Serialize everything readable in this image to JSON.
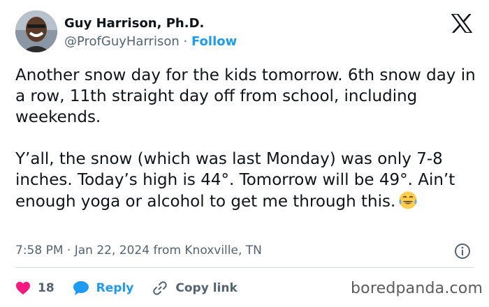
{
  "author": {
    "name": "Guy Harrison, Ph.D.",
    "handle": "@ProfGuyHarrison",
    "separator": "·",
    "follow_label": "Follow"
  },
  "tweet": {
    "paragraph1": "Another snow day for the kids tomorrow. 6th snow day in a row, 11th straight day off from school, including weekends.",
    "paragraph2": "Y’all, the snow (which was last Monday) was only 7-8 inches. Today’s high is 44°. Tomorrow will be 49°. Ain’t enough yoga or alcohol to get me through this.",
    "emoji": "face-with-tears-of-joy"
  },
  "meta": {
    "time": "7:58 PM",
    "separator": "·",
    "date": "Jan 22, 2024",
    "location": "from Knoxville, TN"
  },
  "actions": {
    "like_count": "18",
    "reply_label": "Reply",
    "copy_link_label": "Copy link"
  },
  "watermark": "boredpanda.com",
  "icons": {
    "platform": "x-logo-icon",
    "info": "info-icon",
    "like": "heart-icon",
    "reply": "speech-bubble-icon",
    "copy_link": "link-icon"
  },
  "colors": {
    "accent": "#1d9bf0",
    "like": "#f91880",
    "text": "#0f1419",
    "muted": "#536471"
  }
}
